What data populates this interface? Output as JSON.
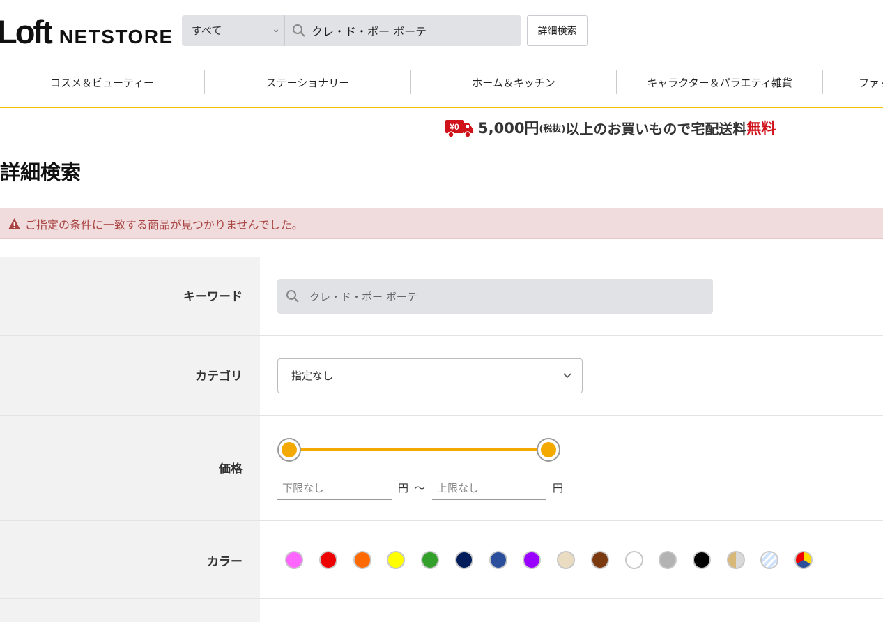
{
  "header": {
    "logo_mark": "Loft",
    "logo_text": "NETSTORE",
    "search_scope": "すべて",
    "search_value": "クレ・ド・ポー ボーテ",
    "advanced_search_label": "詳細検索"
  },
  "nav": {
    "items": [
      {
        "label": "コスメ＆ビューティー"
      },
      {
        "label": "ステーショナリー"
      },
      {
        "label": "ホーム＆キッチン"
      },
      {
        "label": "キャラクター＆パラエティ雑貨"
      },
      {
        "label": "ファッ"
      }
    ]
  },
  "banner": {
    "truck_badge": "¥0",
    "amount": "5,000円",
    "tax_note": "(税抜)",
    "text": "以上のお買いもので宅配送料",
    "free": "無料"
  },
  "page": {
    "title": "詳細検索",
    "alert": "ご指定の条件に一致する商品が見つかりませんでした。"
  },
  "form": {
    "keyword": {
      "label": "キーワード",
      "value": "クレ・ド・ポー ボーテ"
    },
    "category": {
      "label": "カテゴリ",
      "value": "指定なし"
    },
    "price": {
      "label": "価格",
      "min_placeholder": "下限なし",
      "max_placeholder": "上限なし",
      "unit": "円",
      "separator": "～",
      "range_selected_fraction": [
        0,
        1
      ]
    },
    "color": {
      "label": "カラー",
      "swatches": [
        {
          "name": "pink",
          "color": "#ff66ff"
        },
        {
          "name": "red",
          "color": "#ee0000"
        },
        {
          "name": "orange",
          "color": "#ff6a00"
        },
        {
          "name": "yellow",
          "color": "#ffff00"
        },
        {
          "name": "green",
          "color": "#33a02c"
        },
        {
          "name": "navy",
          "color": "#001c5a"
        },
        {
          "name": "blue",
          "color": "#2c4f9c"
        },
        {
          "name": "purple",
          "color": "#9900ff"
        },
        {
          "name": "beige",
          "color": "#eadcc0"
        },
        {
          "name": "brown",
          "color": "#7b3a10"
        },
        {
          "name": "white",
          "color": "#ffffff"
        },
        {
          "name": "gray",
          "color": "#b3b3b3"
        },
        {
          "name": "black",
          "color": "#000000"
        },
        {
          "name": "gold-silver",
          "color": "split"
        },
        {
          "name": "clear",
          "color": "stripes"
        },
        {
          "name": "multi",
          "color": "tri"
        }
      ]
    }
  },
  "colors": {
    "accent_yellow": "#f2c500",
    "slider": "#f4a900",
    "alert_bg": "#f1dcdd",
    "alert_text": "#a94442",
    "free_red": "#d0121b"
  }
}
